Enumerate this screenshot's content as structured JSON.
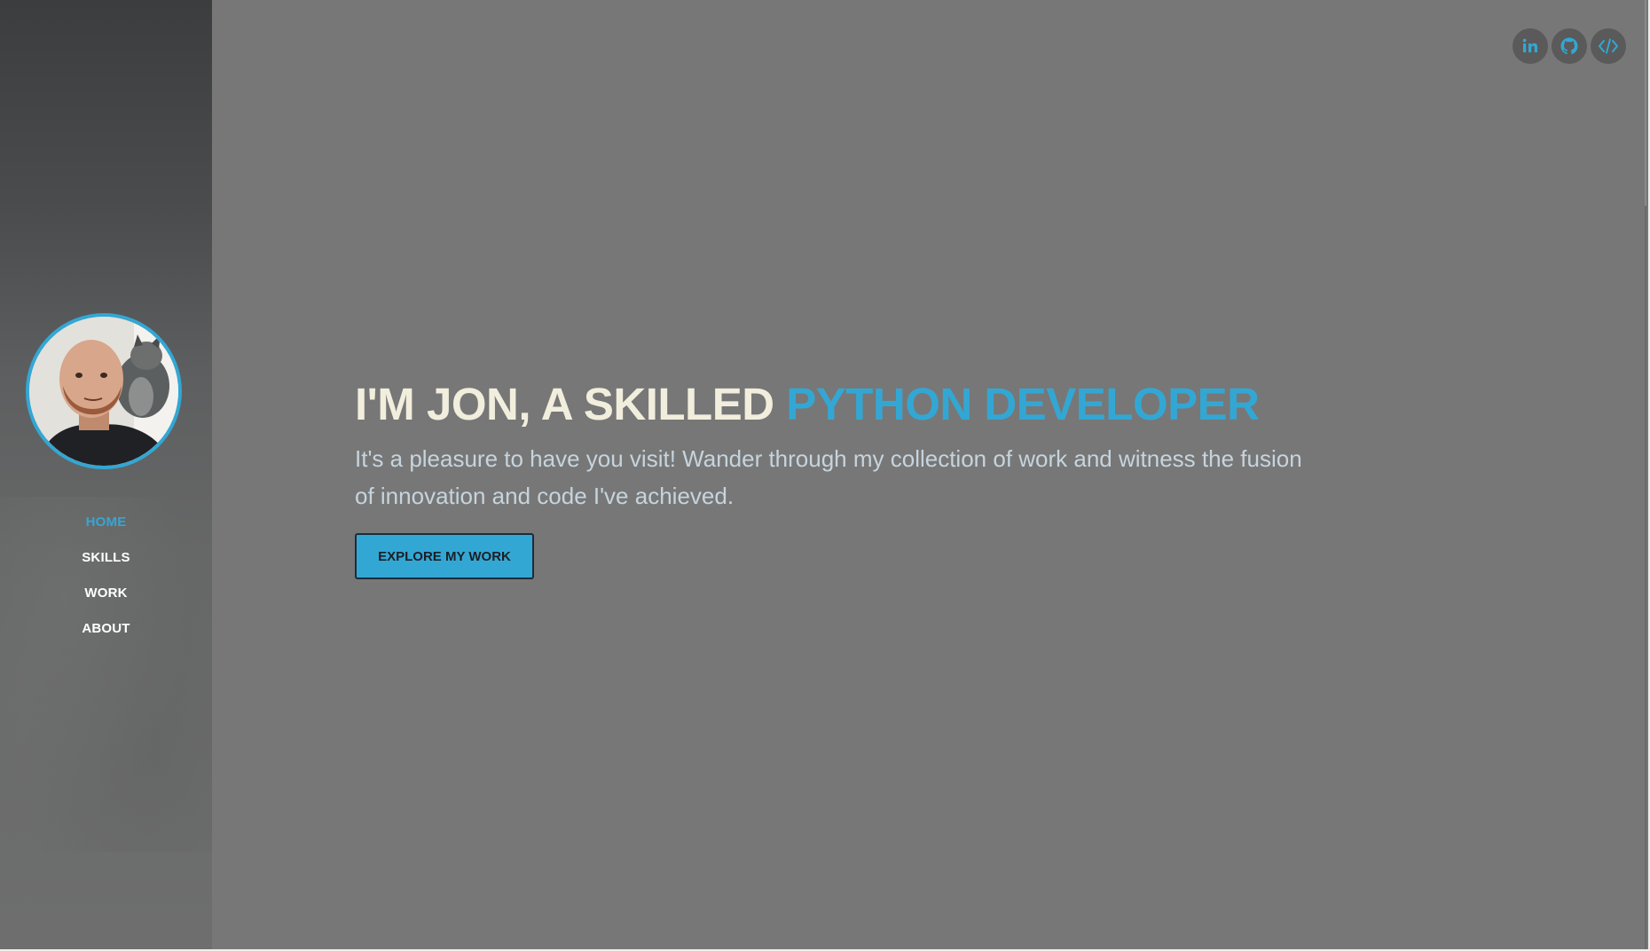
{
  "colors": {
    "accent": "#33a7d4",
    "headline": "#f1eedd",
    "subtext": "#c6d4dd",
    "background": "#777777",
    "button_text": "#1b1f25"
  },
  "sidebar": {
    "avatar_alt": "profile photo with cat",
    "nav": [
      {
        "label": "HOME",
        "active": true
      },
      {
        "label": "SKILLS",
        "active": false
      },
      {
        "label": "WORK",
        "active": false
      },
      {
        "label": "ABOUT",
        "active": false
      }
    ]
  },
  "social": [
    {
      "icon": "linkedin-icon"
    },
    {
      "icon": "github-icon"
    },
    {
      "icon": "code-icon"
    }
  ],
  "hero": {
    "headline_lead": "I'M JON, A SKILLED ",
    "headline_accent": "PYTHON DEVELOPER",
    "subtext": "It's a pleasure to have you visit! Wander through my collection of work and witness the fusion of innovation and code I've achieved.",
    "cta_label": "EXPLORE MY WORK"
  }
}
